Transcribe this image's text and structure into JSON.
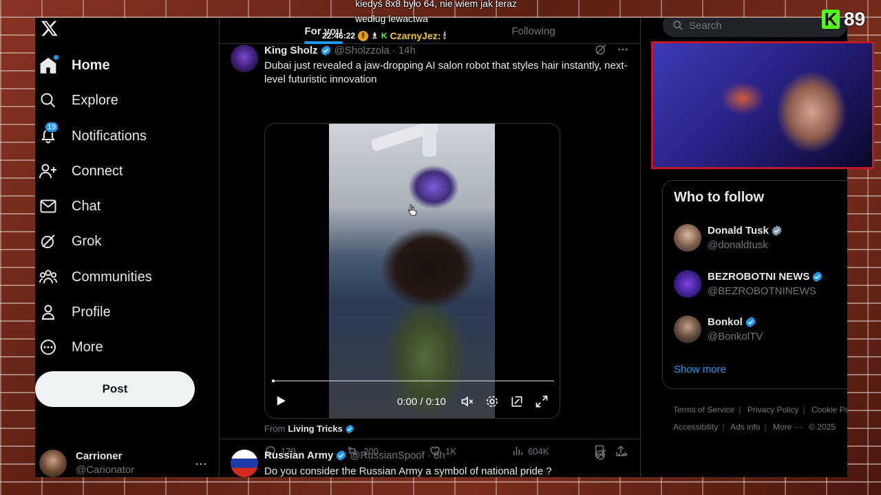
{
  "overlay": {
    "chat_top_1": "kiedyś 8x8 było 64, nie wiem jak teraz",
    "chat_top_2": "według lewactwa",
    "chat_time": "22:46:22",
    "chat_user": "CzarnyJez:",
    "kick_count": "89"
  },
  "nav": {
    "items": [
      {
        "label": "Home",
        "icon": "home-icon"
      },
      {
        "label": "Explore",
        "icon": "search-icon"
      },
      {
        "label": "Notifications",
        "icon": "bell-icon",
        "badge": "19"
      },
      {
        "label": "Connect",
        "icon": "person-plus-icon"
      },
      {
        "label": "Chat",
        "icon": "mail-icon"
      },
      {
        "label": "Grok",
        "icon": "grok-icon"
      },
      {
        "label": "Communities",
        "icon": "communities-icon"
      },
      {
        "label": "Profile",
        "icon": "person-icon"
      },
      {
        "label": "More",
        "icon": "more-circle-icon"
      }
    ],
    "post_label": "Post",
    "account_name": "Carrioner",
    "account_handle": "@Carionator"
  },
  "tabs": {
    "for_you": "For you",
    "following": "Following"
  },
  "tweet1": {
    "name": "King Sholz",
    "handle": "@Sholzzola",
    "time": "14h",
    "text": "Dubai just revealed a jaw-dropping AI salon robot that styles hair instantly, next-level futuristic innovation",
    "video_time": "0:00 / 0:10",
    "video_progress": 0.0,
    "from_label": "From",
    "from_source": "Living Tricks",
    "replies": "179",
    "reposts": "200",
    "likes": "1K",
    "views": "604K"
  },
  "tweet2": {
    "name": "Russian Army",
    "handle": "@RussianSpoof",
    "time": "8h",
    "text": "Do you consider the Russian Army a symbol of national pride ?"
  },
  "right": {
    "search_placeholder": "Search",
    "who_to_follow": "Who to follow",
    "suggestions": [
      {
        "name": "Donald Tusk",
        "handle": "@donaldtusk"
      },
      {
        "name": "BEZROBOTNI NEWS",
        "handle": "@BEZROBOTNINEWS"
      },
      {
        "name": "Bonkol",
        "handle": "@BonkolTV"
      }
    ],
    "show_more": "Show more",
    "footer": {
      "terms": "Terms of Service",
      "privacy": "Privacy Policy",
      "cookie": "Cookie Po",
      "accessibility": "Accessibility",
      "ads": "Ads info",
      "more": "More ···",
      "copyright": "© 2025"
    }
  },
  "colors": {
    "accent": "#1d9bf0",
    "background": "#000000",
    "kick_green": "#53fc18",
    "webcam_border": "#c0182b"
  }
}
